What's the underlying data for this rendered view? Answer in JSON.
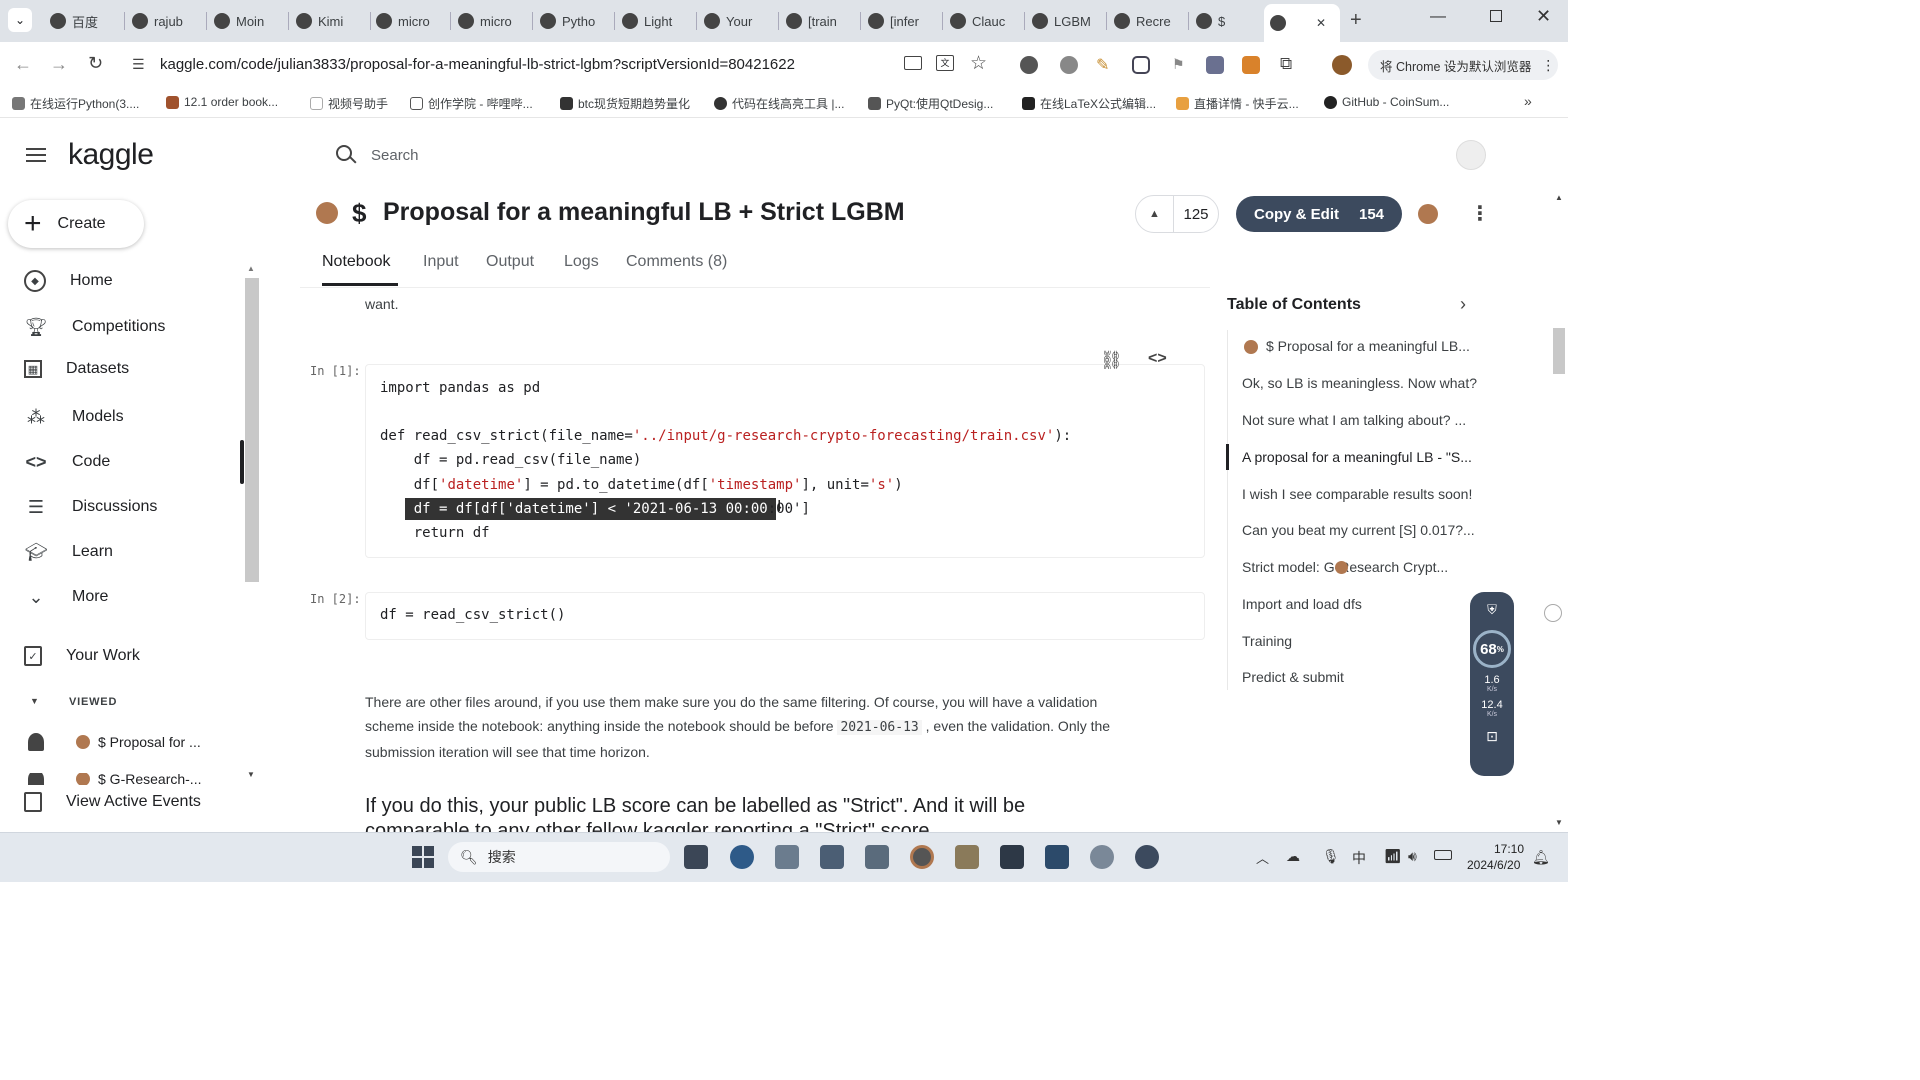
{
  "browser": {
    "tabs": [
      {
        "label": "百度",
        "icon": "baidu-icon"
      },
      {
        "label": "rajub",
        "icon": "github-icon"
      },
      {
        "label": "Moin",
        "icon": "github-icon"
      },
      {
        "label": "Kimi",
        "icon": "kimi-icon"
      },
      {
        "label": "micro",
        "icon": "github-icon"
      },
      {
        "label": "micro",
        "icon": "github-icon"
      },
      {
        "label": "Pytho",
        "icon": "stack-icon"
      },
      {
        "label": "Light",
        "icon": "github-icon"
      },
      {
        "label": "Your",
        "icon": "kaggle-icon"
      },
      {
        "label": "[train",
        "icon": "kaggle-icon"
      },
      {
        "label": "[infer",
        "icon": "kaggle-icon"
      },
      {
        "label": "Clauc",
        "icon": "claude-icon"
      },
      {
        "label": "LGBM",
        "icon": "kaggle-icon"
      },
      {
        "label": "Recre",
        "icon": "kaggle-icon"
      },
      {
        "label": "$",
        "icon": "kaggle-icon"
      },
      {
        "label": "",
        "icon": "kaggle-icon"
      }
    ],
    "url": "kaggle.com/code/julian3833/proposal-for-a-meaningful-lb-strict-lgbm?scriptVersionId=80421622",
    "default_browser_button": "将 Chrome 设为默认浏览器",
    "bookmarks": [
      "在线运行Python(3....",
      "12.1 order book...",
      "视频号助手",
      "创作学院 - 哔哩哔...",
      "btc现货短期趋势量化",
      "代码在线高亮工具 |...",
      "PyQt:使用QtDesig...",
      "在线LaTeX公式编辑...",
      "直播详情 - 快手云...",
      "GitHub - CoinSum..."
    ]
  },
  "kaggle": {
    "logo": "kaggle",
    "search_placeholder": "Search",
    "create_label": "Create",
    "nav": [
      {
        "label": "Home",
        "icon": "compass-icon"
      },
      {
        "label": "Competitions",
        "icon": "trophy-icon"
      },
      {
        "label": "Datasets",
        "icon": "table-icon"
      },
      {
        "label": "Models",
        "icon": "models-icon"
      },
      {
        "label": "Code",
        "icon": "code-icon"
      },
      {
        "label": "Discussions",
        "icon": "discussion-icon"
      },
      {
        "label": "Learn",
        "icon": "school-icon"
      },
      {
        "label": "More",
        "icon": "chevron-down-icon"
      }
    ],
    "your_work": "Your Work",
    "viewed_header": "VIEWED",
    "viewed_items": [
      "$ Proposal for ...",
      "$ G-Research-..."
    ],
    "view_active_events": "View Active Events",
    "title": "Proposal for a meaningful LB + Strict LGBM",
    "title_prefix": "$",
    "vote_count": "125",
    "copy_edit_label": "Copy & Edit",
    "copy_edit_count": "154",
    "tabs": [
      "Notebook",
      "Input",
      "Output",
      "Logs",
      "Comments (8)"
    ],
    "text_top": "want.",
    "cell1_prompt": "In [1]:",
    "cell2_prompt": "In [2]:",
    "cell2_code": "df = read_csv_strict()",
    "para1_a": "There are other files around, if you use them make sure you do the same filtering. Of course, you will have a validation",
    "para1_b": "scheme inside the notebook: anything inside the notebook should be before",
    "para1_code": "2021-06-13",
    "para1_c": ", even the validation. Only the",
    "para1_d": "submission iteration will see that time horizon.",
    "heading_line1": "If you do this, your public LB score can be labelled as \"Strict\". And it will be",
    "heading_line2": "comparable to any other fellow kaggler reporting a \"Strict\" score",
    "toc_title": "Table of Contents",
    "toc": [
      "$ Proposal for a meaningful LB...",
      "Ok, so LB is meaningless. Now what?",
      "Not sure what I am talking about? ...",
      "A proposal for a meaningful LB - \"S...",
      "I wish I see comparable results soon!",
      "Can you beat my current [S] 0.017?...",
      "Strict model:  G-Research Crypt...",
      "Import and load dfs",
      "Training",
      "Predict & submit"
    ]
  },
  "widget": {
    "percent": "68",
    "up_speed": "1.6",
    "down_speed": "12.4",
    "unit": "K/s"
  },
  "taskbar": {
    "search": "搜索",
    "ime": "中",
    "time": "17:10",
    "date": "2024/6/20"
  }
}
